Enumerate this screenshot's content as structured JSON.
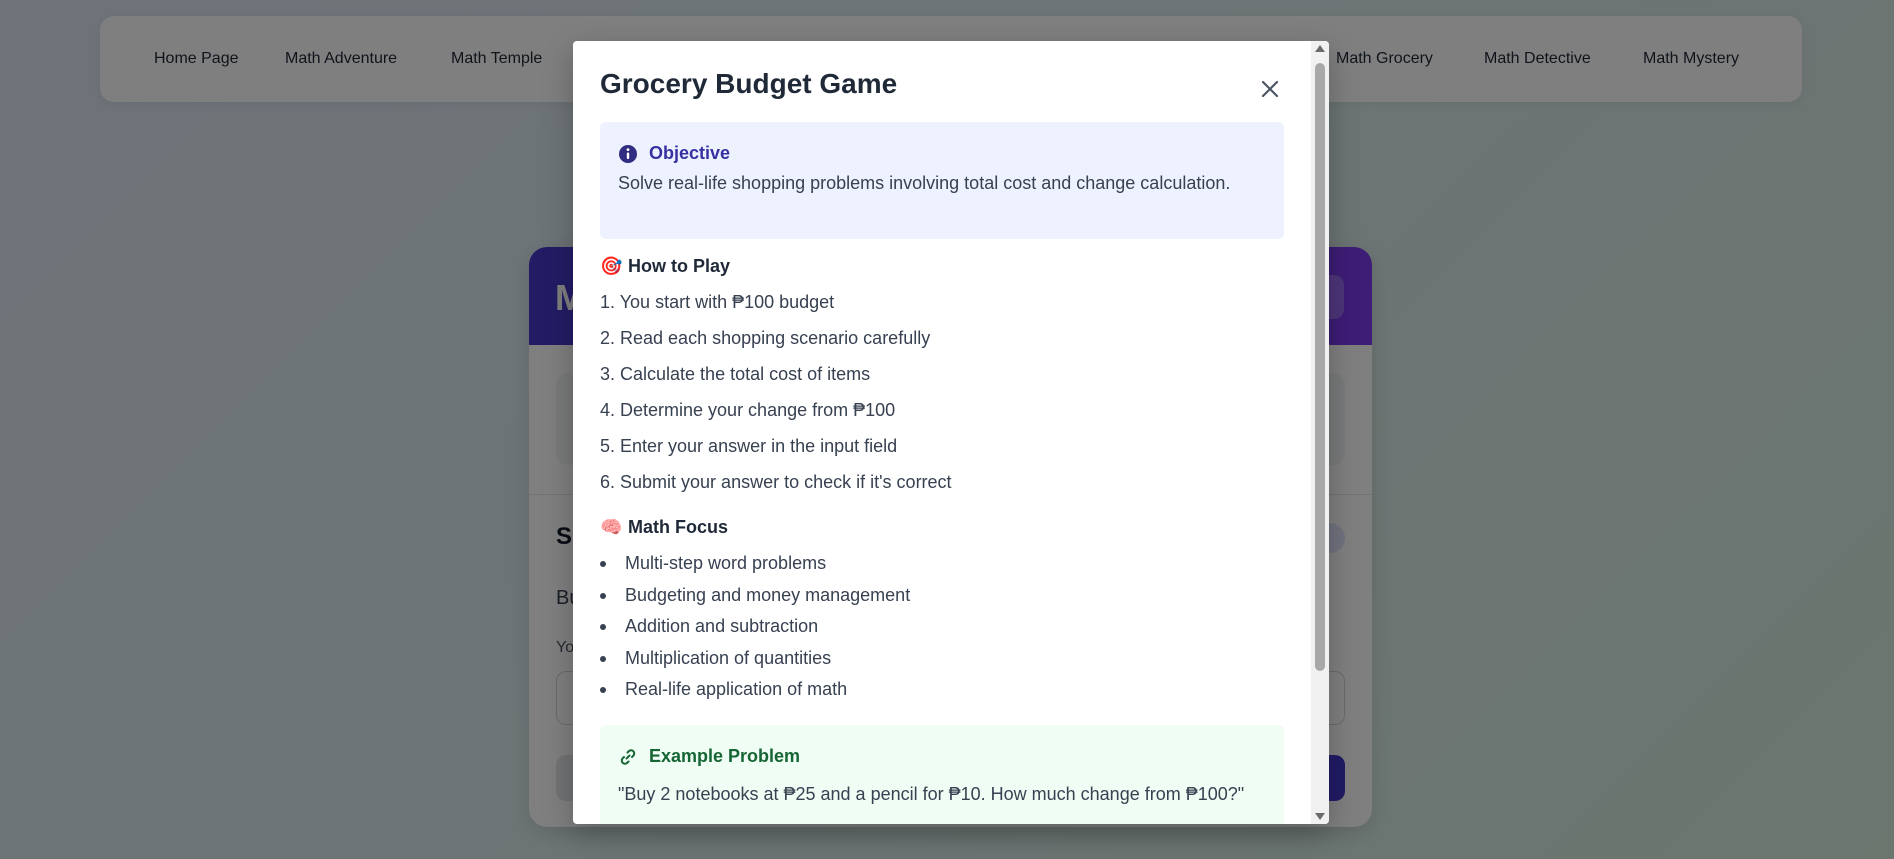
{
  "nav": {
    "items": [
      {
        "label": "Home Page"
      },
      {
        "label": "Math Adventure"
      },
      {
        "label": "Math Temple"
      },
      {
        "label": "Math Grocery"
      },
      {
        "label": "Math Detective"
      },
      {
        "label": "Math Mystery"
      }
    ]
  },
  "background_card": {
    "header_title": "M",
    "section_title": "S",
    "question": "Bu",
    "answer_label": "Yo"
  },
  "modal": {
    "title": "Grocery Budget Game",
    "close_icon": "close-icon",
    "objective": {
      "icon": "info-icon",
      "title": "Objective",
      "text": "Solve real-life shopping problems involving total cost and change calculation."
    },
    "how_to_play": {
      "emoji": "🎯",
      "title": "How to Play",
      "steps": [
        "1. You start with ₱100 budget",
        "2. Read each shopping scenario carefully",
        "3. Calculate the total cost of items",
        "4. Determine your change from ₱100",
        "5. Enter your answer in the input field",
        "6. Submit your answer to check if it's correct"
      ]
    },
    "math_focus": {
      "emoji": "🧠",
      "title": "Math Focus",
      "items": [
        "Multi-step word problems",
        "Budgeting and money management",
        "Addition and subtraction",
        "Multiplication of quantities",
        "Real-life application of math"
      ]
    },
    "example": {
      "icon": "link-icon",
      "title": "Example Problem",
      "text": "\"Buy 2 notebooks at ₱25 and a pencil for ₱10. How much change from ₱100?\""
    }
  },
  "colors": {
    "header_gradient_start": "#4338ca",
    "header_gradient_end": "#7c3aed",
    "objective_bg": "#eef2ff",
    "objective_title": "#3730a3",
    "example_bg": "#f0fdf4",
    "example_title": "#166534"
  }
}
